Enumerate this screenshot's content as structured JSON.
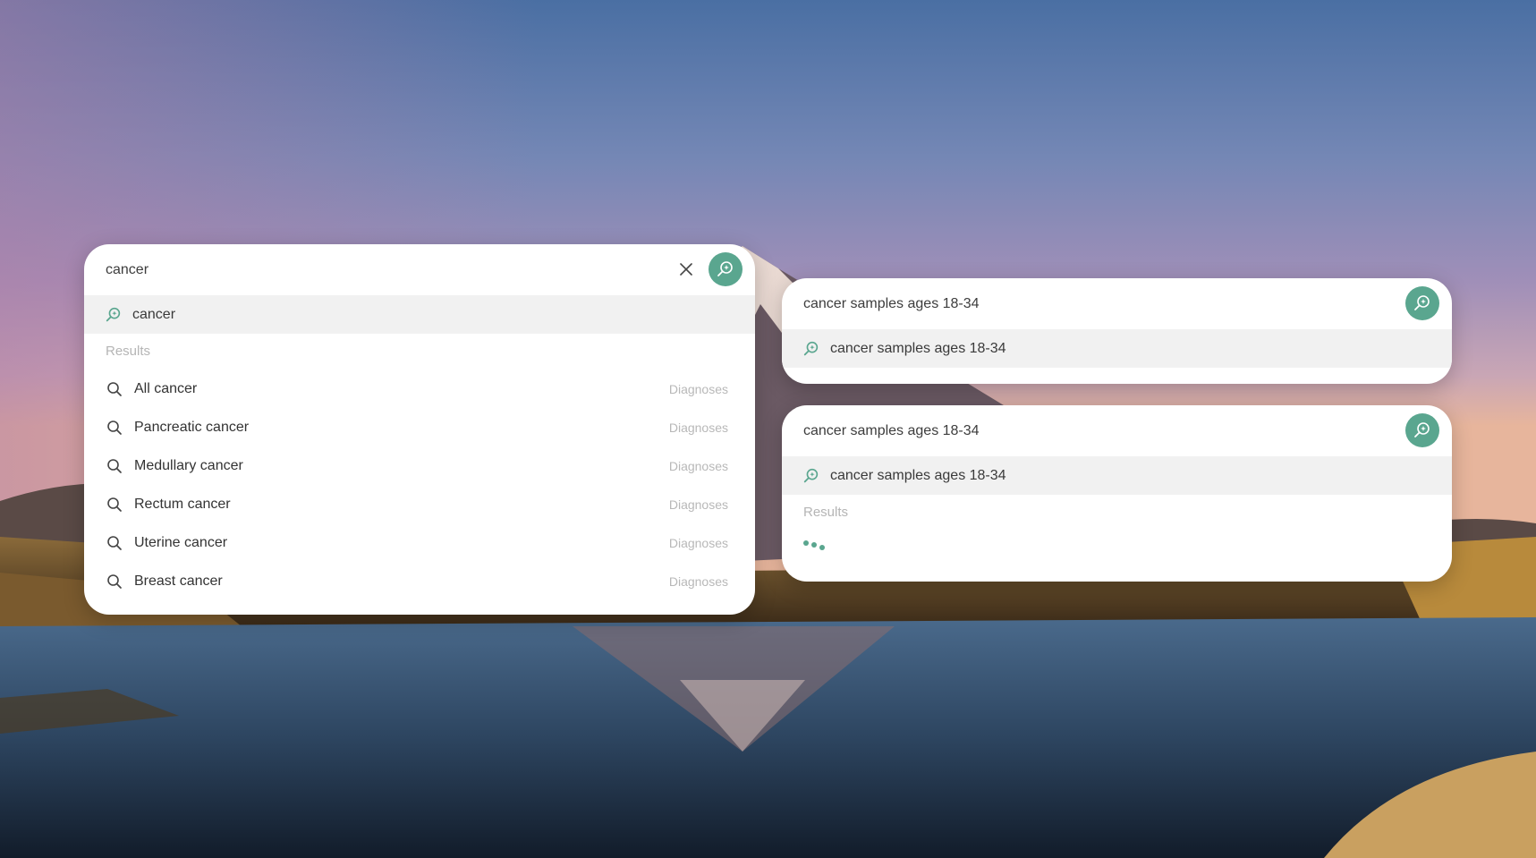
{
  "colors": {
    "accent": "#5aa68f",
    "suggestion_bg": "#f1f1f1",
    "muted_text": "#b5b5b5"
  },
  "icons": {
    "assistant": "assistant-search-icon",
    "search": "search-icon",
    "clear": "close-icon"
  },
  "panel_main": {
    "query": "cancer",
    "suggestion": "cancer",
    "results_label": "Results",
    "results": [
      {
        "label": "All cancer",
        "tag": "Diagnoses"
      },
      {
        "label": "Pancreatic cancer",
        "tag": "Diagnoses"
      },
      {
        "label": "Medullary cancer",
        "tag": "Diagnoses"
      },
      {
        "label": "Rectum cancer",
        "tag": "Diagnoses"
      },
      {
        "label": "Uterine cancer",
        "tag": "Diagnoses"
      },
      {
        "label": "Breast cancer",
        "tag": "Diagnoses"
      }
    ]
  },
  "panel_top_right": {
    "query": "cancer samples ages 18-34",
    "suggestion": "cancer samples ages 18-34"
  },
  "panel_bottom_right": {
    "query": "cancer samples ages 18-34",
    "suggestion": "cancer samples ages 18-34",
    "results_label": "Results"
  }
}
